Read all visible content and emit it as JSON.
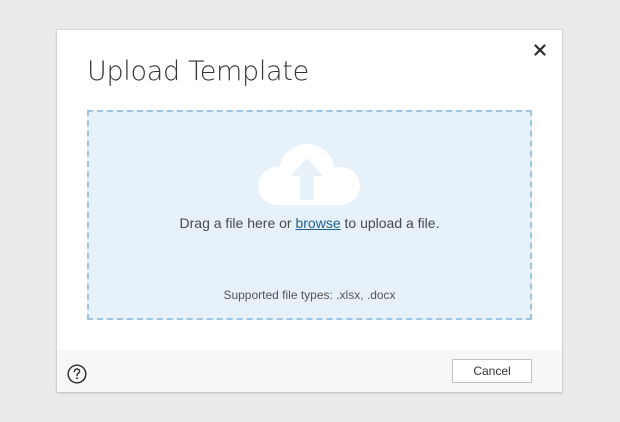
{
  "dialog": {
    "title": "Upload Template",
    "close_icon": "close-icon"
  },
  "dropzone": {
    "icon": "cloud-upload-icon",
    "text_before": "Drag a file here or ",
    "browse_label": "browse",
    "text_after": " to upload a file.",
    "supported_types": "Supported file types: .xlsx, .docx"
  },
  "footer": {
    "help_icon": "help-icon",
    "cancel_label": "Cancel"
  },
  "colors": {
    "dropzone_bg": "#e6f1fa",
    "dropzone_border": "#9cc6e4",
    "link": "#1f5e94",
    "cloud": "#ffffff"
  }
}
